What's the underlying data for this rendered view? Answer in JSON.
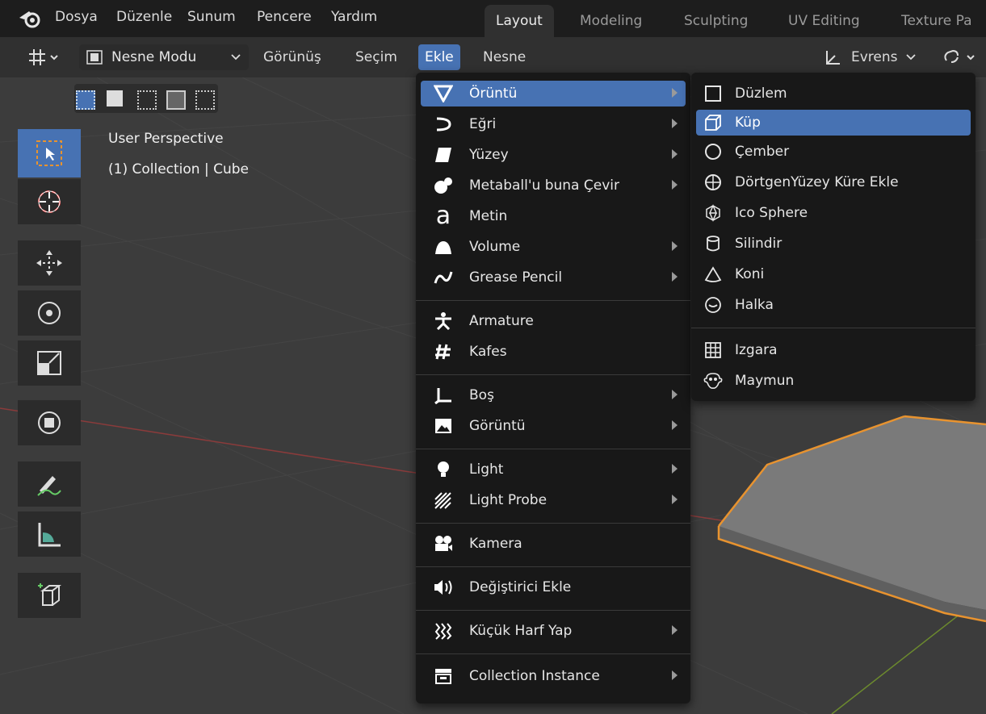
{
  "topbar": {
    "menus": [
      "Dosya",
      "Düzenle",
      "Sunum",
      "Pencere",
      "Yardım"
    ],
    "workspaces": [
      "Layout",
      "Modeling",
      "Sculpting",
      "UV Editing",
      "Texture Pa"
    ],
    "active_workspace": "Layout"
  },
  "header": {
    "mode": "Nesne Modu",
    "view": "Görünüş",
    "select": "Seçim",
    "add": "Ekle",
    "object": "Nesne",
    "orientation": "Evrens"
  },
  "viewport": {
    "perspective": "User Perspective",
    "collection": "(1) Collection | Cube"
  },
  "add_menu": {
    "items": [
      {
        "label": "Örüntü",
        "icon": "mesh-icon",
        "submenu": true,
        "highlighted": true
      },
      {
        "label": "Eğri",
        "icon": "curve-icon",
        "submenu": true
      },
      {
        "label": "Yüzey",
        "icon": "surface-icon",
        "submenu": true
      },
      {
        "label": "Metaball'u buna Çevir",
        "icon": "metaball-icon",
        "submenu": true
      },
      {
        "label": "Metin",
        "icon": "text-icon",
        "submenu": false
      },
      {
        "label": "Volume",
        "icon": "volume-icon",
        "submenu": true
      },
      {
        "label": "Grease Pencil",
        "icon": "grease-pencil-icon",
        "submenu": true
      },
      {
        "label": "Armature",
        "icon": "armature-icon",
        "submenu": false
      },
      {
        "label": "Kafes",
        "icon": "lattice-icon",
        "submenu": false
      },
      {
        "label": "Boş",
        "icon": "empty-icon",
        "submenu": true
      },
      {
        "label": "Görüntü",
        "icon": "image-icon",
        "submenu": true
      },
      {
        "label": "Light",
        "icon": "light-icon",
        "submenu": true
      },
      {
        "label": "Light Probe",
        "icon": "light-probe-icon",
        "submenu": true
      },
      {
        "label": "Kamera",
        "icon": "camera-icon",
        "submenu": false
      },
      {
        "label": "Değiştirici Ekle",
        "icon": "speaker-icon",
        "submenu": false
      },
      {
        "label": "Küçük Harf Yap",
        "icon": "force-field-icon",
        "submenu": true
      },
      {
        "label": "Collection Instance",
        "icon": "collection-icon",
        "submenu": true
      }
    ]
  },
  "mesh_menu": {
    "items": [
      {
        "label": "Düzlem",
        "icon": "plane-icon"
      },
      {
        "label": "Küp",
        "icon": "cube-icon",
        "highlighted": true
      },
      {
        "label": "Çember",
        "icon": "circle-icon"
      },
      {
        "label": "DörtgenYüzey Küre Ekle",
        "icon": "uv-sphere-icon"
      },
      {
        "label": "Ico Sphere",
        "icon": "ico-sphere-icon"
      },
      {
        "label": "Silindir",
        "icon": "cylinder-icon"
      },
      {
        "label": "Koni",
        "icon": "cone-icon"
      },
      {
        "label": "Halka",
        "icon": "torus-icon"
      },
      {
        "label": "Izgara",
        "icon": "grid-icon"
      },
      {
        "label": "Maymun",
        "icon": "monkey-icon"
      }
    ]
  },
  "colors": {
    "accent": "#4772b3",
    "selection_outline": "#e8932f",
    "menu_bg": "#181818"
  }
}
